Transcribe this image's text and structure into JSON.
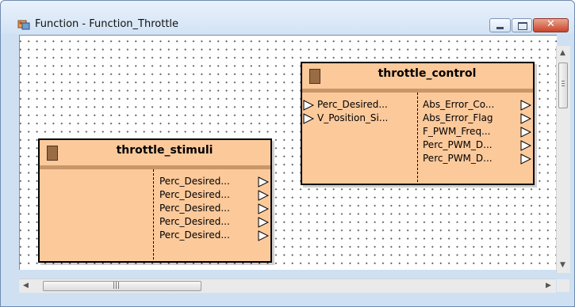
{
  "window": {
    "title": "Function - Function_Throttle",
    "close_symbol": "✕"
  },
  "icons": {
    "app": "function-block-icon",
    "minimize": "minimize-icon",
    "maximize": "maximize-icon",
    "close": "close-icon",
    "port": "port-triangle-icon"
  },
  "scrollbar": {
    "up_arrow": "▲",
    "down_arrow": "▼",
    "left_arrow": "◀",
    "right_arrow": "▶",
    "thumb_grip": "|||"
  },
  "blocks": [
    {
      "id": "throttle_stimuli",
      "name": "throttle_stimuli",
      "inputs": [],
      "outputs": [
        "Perc_Desired...",
        "Perc_Desired...",
        "Perc_Desired...",
        "Perc_Desired...",
        "Perc_Desired..."
      ]
    },
    {
      "id": "throttle_control",
      "name": "throttle_control",
      "inputs": [
        "Perc_Desired...",
        "V_Position_Si..."
      ],
      "outputs": [
        "Abs_Error_Co...",
        "Abs_Error_Flag",
        "F_PWM_Freq...",
        "Perc_PWM_D...",
        "Perc_PWM_D..."
      ]
    }
  ],
  "colors": {
    "block_fill": "#fcc99b",
    "block_header_band": "#c89769",
    "block_swatch": "#9a6c45",
    "close_button": "#c9442b"
  }
}
